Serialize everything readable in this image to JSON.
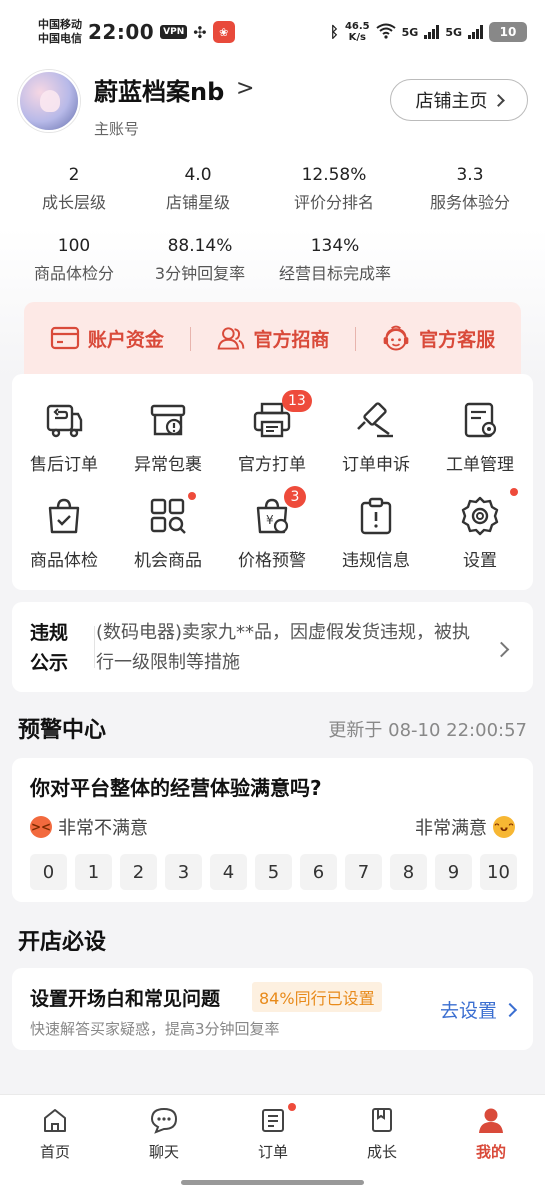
{
  "status_bar": {
    "carrier1": "中国移动",
    "carrier2": "中国电信",
    "time": "22:00",
    "vpn": "VPN",
    "speed_value": "46.5",
    "speed_unit": "K/s",
    "network1": "5G",
    "network2": "5G",
    "battery": "10"
  },
  "header": {
    "shop_name": "蔚蓝档案nb",
    "account_type": "主账号",
    "store_home_button": "店铺主页"
  },
  "metrics_row1": [
    {
      "value": "2",
      "label": "成长层级"
    },
    {
      "value": "4.0",
      "label": "店铺星级"
    },
    {
      "value": "12.58%",
      "label": "评价分排名"
    },
    {
      "value": "3.3",
      "label": "服务体验分"
    }
  ],
  "metrics_row2": [
    {
      "value": "100",
      "label": "商品体检分"
    },
    {
      "value": "88.14%",
      "label": "3分钟回复率"
    },
    {
      "value": "134%",
      "label": "经营目标完成率"
    }
  ],
  "quick_actions": [
    {
      "label": "账户资金",
      "icon": "wallet-icon"
    },
    {
      "label": "官方招商",
      "icon": "users-icon"
    },
    {
      "label": "官方客服",
      "icon": "service-icon"
    }
  ],
  "tools": [
    {
      "label": "售后订单",
      "icon": "truck-return-icon"
    },
    {
      "label": "异常包裹",
      "icon": "package-alert-icon"
    },
    {
      "label": "官方打单",
      "icon": "printer-icon",
      "badge": "13"
    },
    {
      "label": "订单申诉",
      "icon": "gavel-icon"
    },
    {
      "label": "工单管理",
      "icon": "ticket-icon"
    },
    {
      "label": "商品体检",
      "icon": "bag-check-icon"
    },
    {
      "label": "机会商品",
      "icon": "grid-search-icon",
      "dot": true
    },
    {
      "label": "价格预警",
      "icon": "price-bag-icon",
      "badge": "3"
    },
    {
      "label": "违规信息",
      "icon": "clipboard-alert-icon"
    },
    {
      "label": "设置",
      "icon": "gear-icon",
      "dot": true
    }
  ],
  "notice": {
    "title": "违规公示",
    "text": "(数码电器)卖家九**品，因虚假发货违规，被执行一级限制等措施"
  },
  "warning_center": {
    "title": "预警中心",
    "update_time": "更新于 08-10 22:00:57"
  },
  "survey": {
    "question": "你对平台整体的经营体验满意吗?",
    "low_label": "非常不满意",
    "high_label": "非常满意",
    "scores": [
      "0",
      "1",
      "2",
      "3",
      "4",
      "5",
      "6",
      "7",
      "8",
      "9",
      "10"
    ]
  },
  "setup_section": {
    "title": "开店必设",
    "item_title": "设置开场白和常见问题",
    "tag": "84%同行已设置",
    "desc": "快速解答买家疑惑，提高3分钟回复率",
    "action": "去设置"
  },
  "bottom_nav": [
    {
      "label": "首页",
      "icon": "home-icon"
    },
    {
      "label": "聊天",
      "icon": "chat-icon"
    },
    {
      "label": "订单",
      "icon": "order-icon",
      "dot": true
    },
    {
      "label": "成长",
      "icon": "book-icon"
    },
    {
      "label": "我的",
      "icon": "user-icon",
      "active": true
    }
  ],
  "colors": {
    "accent_red": "#d94a3a",
    "badge_red": "#ee4b3b",
    "link_blue": "#3b6fd1",
    "tag_orange": "#e88a1a"
  }
}
